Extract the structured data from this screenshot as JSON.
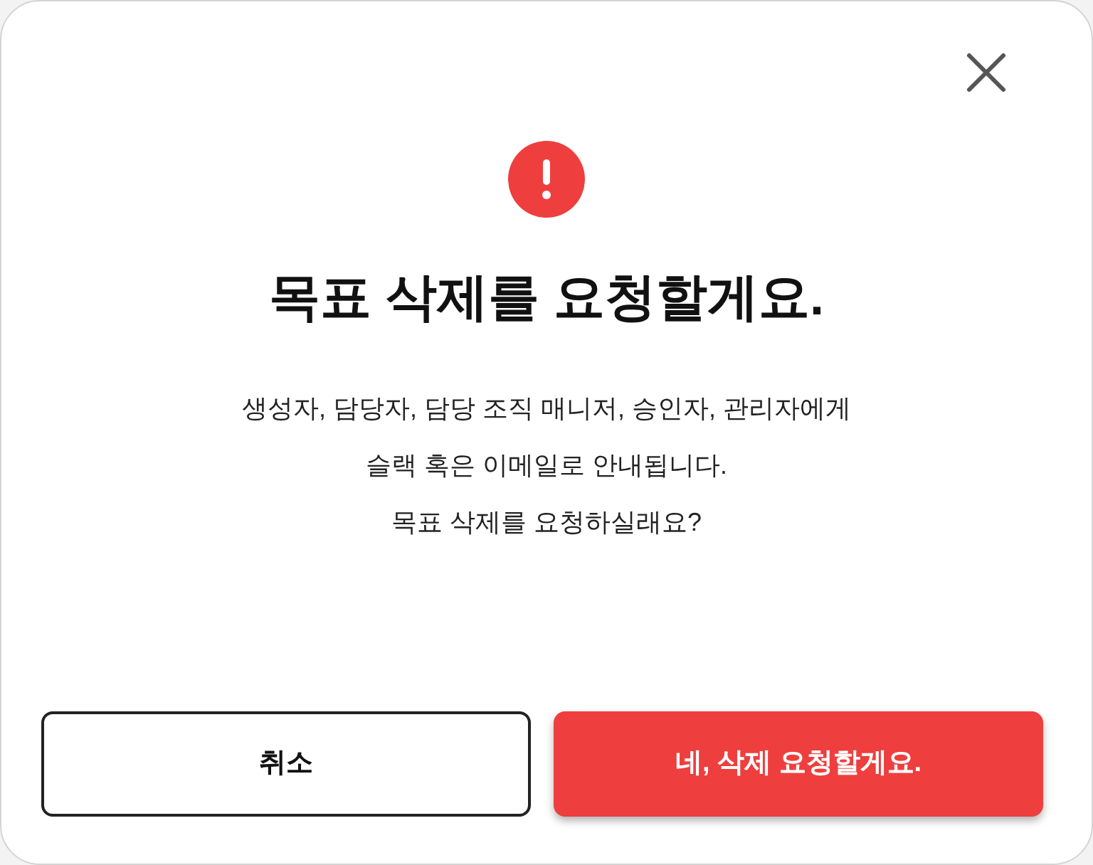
{
  "dialog": {
    "title": "목표 삭제를 요청할게요.",
    "message": [
      "생성자, 담당자, 담당 조직 매니저, 승인자, 관리자에게",
      "슬랙 혹은 이메일로 안내됩니다.",
      "목표 삭제를 요청하실래요?"
    ],
    "buttons": [
      {
        "label": "취소",
        "kind": "secondary"
      },
      {
        "label": "네, 삭제 요청할게요.",
        "kind": "primary"
      }
    ]
  }
}
